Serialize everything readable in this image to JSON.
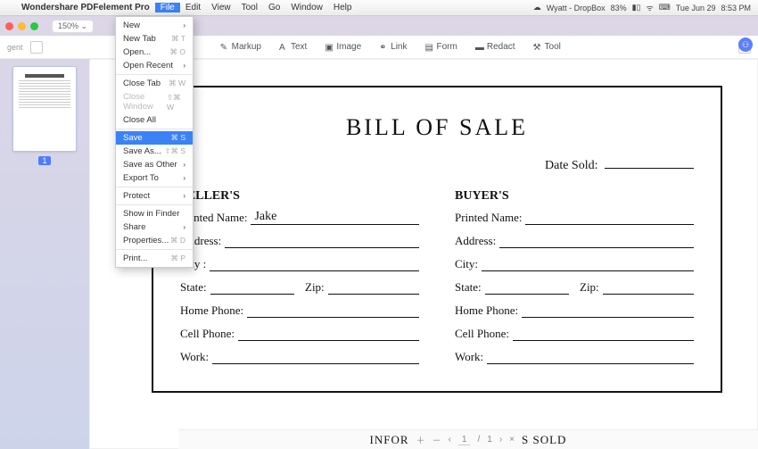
{
  "menubar": {
    "app_name": "Wondershare PDFelement Pro",
    "items": [
      "File",
      "Edit",
      "View",
      "Tool",
      "Go",
      "Window",
      "Help"
    ],
    "active_index": 0,
    "right": {
      "battery": "83%",
      "date": "Tue Jun 29",
      "time": "8:53 PM",
      "account": "Wyatt - DropBox"
    }
  },
  "chrome": {
    "zoom": "150% ⌄",
    "title": ""
  },
  "dropdown": {
    "groups": [
      [
        {
          "label": "New",
          "shortcut": "",
          "submenu": true
        },
        {
          "label": "New Tab",
          "shortcut": "⌘ T"
        },
        {
          "label": "Open...",
          "shortcut": "⌘ O"
        },
        {
          "label": "Open Recent",
          "submenu": true
        }
      ],
      [
        {
          "label": "Close Tab",
          "shortcut": "⌘ W"
        },
        {
          "label": "Close Window",
          "shortcut": "⇧⌘ W",
          "disabled": true
        },
        {
          "label": "Close All"
        }
      ],
      [
        {
          "label": "Save",
          "shortcut": "⌘ S",
          "selected": true
        },
        {
          "label": "Save As...",
          "shortcut": "⇧⌘ S"
        },
        {
          "label": "Save as Other",
          "submenu": true
        },
        {
          "label": "Export To",
          "submenu": true
        }
      ],
      [
        {
          "label": "Protect",
          "submenu": true
        }
      ],
      [
        {
          "label": "Show in Finder"
        },
        {
          "label": "Share",
          "submenu": true
        },
        {
          "label": "Properties...",
          "shortcut": "⌘ D"
        }
      ],
      [
        {
          "label": "Print...",
          "shortcut": "⌘ P"
        }
      ]
    ]
  },
  "toolbar": {
    "tools": [
      {
        "name": "markup",
        "label": "Markup"
      },
      {
        "name": "text",
        "label": "Text"
      },
      {
        "name": "image",
        "label": "Image"
      },
      {
        "name": "link",
        "label": "Link"
      },
      {
        "name": "form",
        "label": "Form"
      },
      {
        "name": "redact",
        "label": "Redact"
      },
      {
        "name": "tool",
        "label": "Tool"
      }
    ]
  },
  "sidebar": {
    "page_number": "1",
    "tab_fragment": "gent"
  },
  "document": {
    "title": "BILL OF SALE",
    "date_label": "Date Sold:",
    "seller_heading": "SELLER'S",
    "buyer_heading": "BUYER'S",
    "fields": {
      "printed_name": "Printed Name:",
      "address": "Address:",
      "city": "City :",
      "city2": "City:",
      "state": "State:",
      "zip": "Zip:",
      "home_phone": "Home Phone:",
      "cell_phone": "Cell Phone:",
      "work": "Work:"
    },
    "seller_values": {
      "printed_name": "Jake"
    }
  },
  "footer": {
    "left_frag": "INFOR",
    "page": "1",
    "total": "1",
    "right_frag": "S SOLD"
  }
}
